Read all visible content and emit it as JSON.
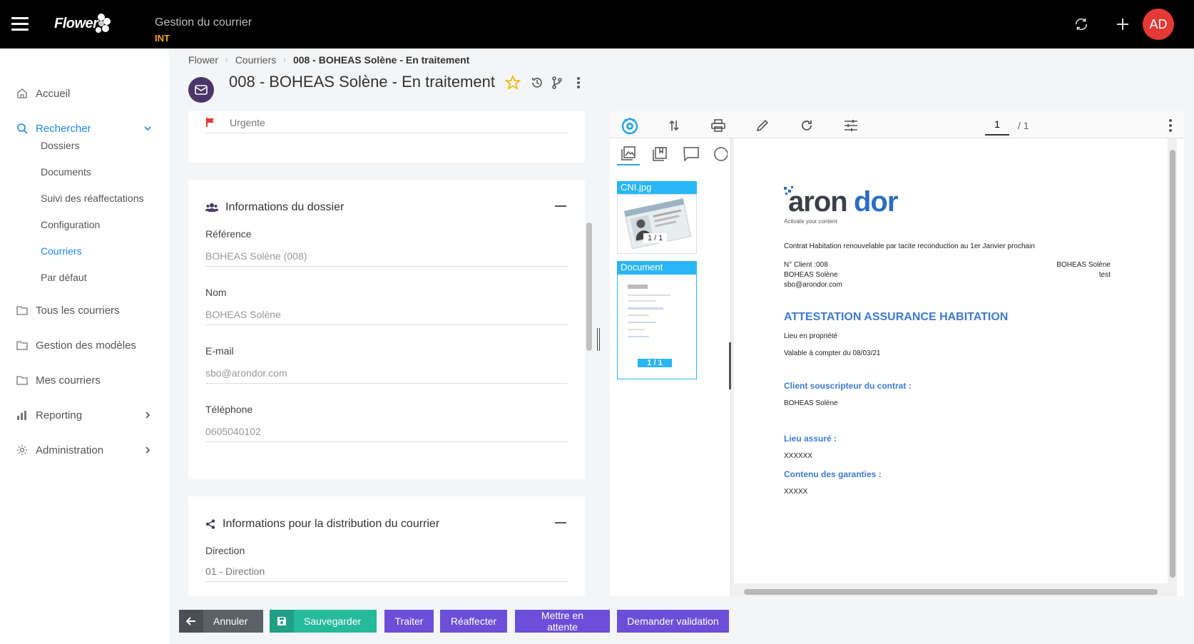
{
  "topbar": {
    "logo_text": "Flower",
    "app_title": "Gestion du courrier",
    "env": "INT",
    "avatar_initials": "AD",
    "icons": [
      "menu-icon",
      "sync-icon",
      "plus-icon"
    ]
  },
  "sidebar": {
    "items": [
      {
        "label": "Accueil",
        "icon": "home-icon"
      },
      {
        "label": "Rechercher",
        "icon": "search-icon"
      },
      {
        "label": "Tous les courriers",
        "icon": "folder-icon"
      },
      {
        "label": "Gestion des modèles",
        "icon": "folder-icon"
      },
      {
        "label": "Mes courriers",
        "icon": "folder-icon"
      },
      {
        "label": "Reporting",
        "icon": "bar-chart-icon"
      },
      {
        "label": "Administration",
        "icon": "gear-icon"
      }
    ],
    "subitems": [
      "Dossiers",
      "Documents",
      "Suivi des réaffectations",
      "Configuration",
      "Courriers",
      "Par défaut"
    ]
  },
  "breadcrumb": [
    "Flower",
    "Courriers",
    "008 - BOHEAS Solène - En traitement"
  ],
  "page_title": "008 - BOHEAS Solène - En traitement",
  "form": {
    "priority_label": "Urgente",
    "dossier": {
      "title": "Informations du dossier",
      "fields": [
        {
          "label": "Référence",
          "value": "BOHEAS Solène (008)"
        },
        {
          "label": "Nom",
          "value": "BOHEAS Solène"
        },
        {
          "label": "E-mail",
          "value": "sbo@arondor.com"
        },
        {
          "label": "Téléphone",
          "value": "0605040102"
        }
      ]
    },
    "distribution": {
      "title": "Informations pour la distribution du courrier",
      "direction_label": "Direction",
      "direction_value": "01 - Direction"
    }
  },
  "viewer": {
    "page_current": "1",
    "page_total": "/ 1",
    "thumbnails": [
      {
        "name": "CNI.jpg",
        "pages": "1 / 1"
      },
      {
        "name": "Document",
        "pages": "1 / 1"
      }
    ],
    "document": {
      "logo_main": "arondor",
      "logo_tagline": "Activate your content",
      "contract_line": "Contrat Habitation renouvelable par tacite reconduction au 1er Janvier prochain",
      "client_no": "N° Client :008",
      "client_name": "BOHEAS Solène",
      "client_email": "sbo@arondor.com",
      "right_name": "BOHEAS Solène",
      "right_note": "test",
      "heading": "ATTESTATION ASSURANCE HABITATION",
      "lieu_prop": "Lieu en propriété",
      "valable": "Valable à compter du 08/03/21",
      "sec1_title": "Client souscripteur du contrat :",
      "sec1_value": "BOHEAS Solène",
      "sec2_title": "Lieu assuré :",
      "sec2_value": "XXXXXX",
      "sec3_title": "Contenu des garanties :",
      "sec3_value": "XXXXX"
    }
  },
  "footer": {
    "cancel": "Annuler",
    "save": "Sauvegarder",
    "process": "Traiter",
    "reassign": "Réaffecter",
    "hold": "Mettre en attente",
    "validate": "Demander validation"
  },
  "colors": {
    "accent": "#1e88e5",
    "purple_btn": "#6c4fd8",
    "save_btn": "#26b99a",
    "cancel_btn": "#5a6268",
    "avatar": "#e53935",
    "env": "#f5a623"
  }
}
